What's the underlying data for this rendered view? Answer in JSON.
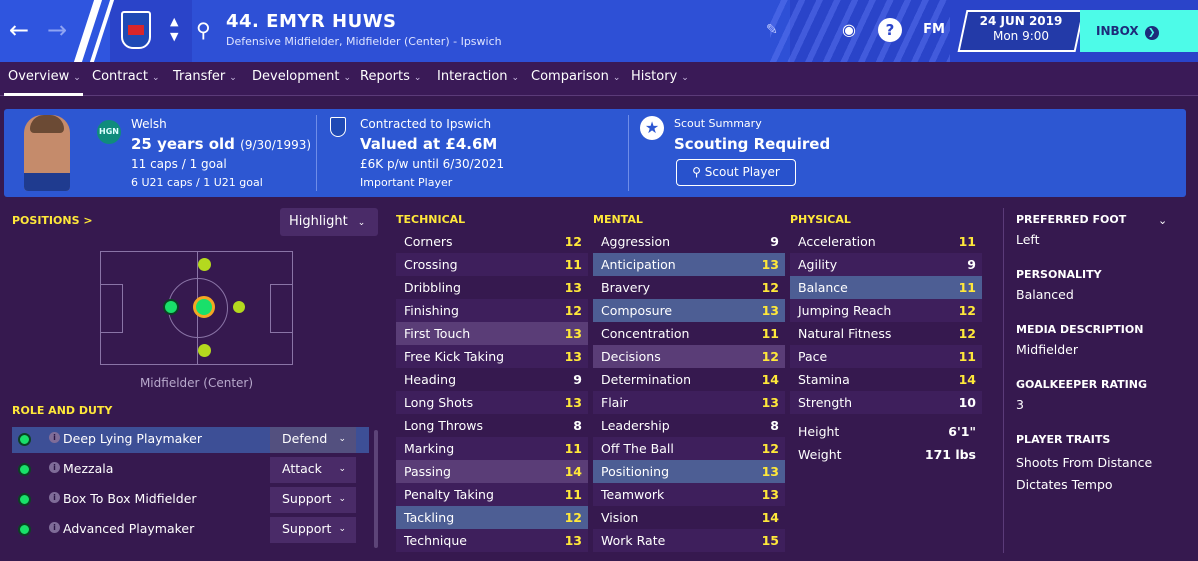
{
  "header": {
    "player_name": "44. EMYR HUWS",
    "player_sub": "Defensive Midfielder, Midfielder (Center) - Ipswich",
    "date": "24 JUN 2019",
    "time": "Mon 9:00",
    "fm_label": "FM",
    "inbox_label": "INBOX",
    "help_label": "?"
  },
  "tabs": [
    "Overview",
    "Contract",
    "Transfer",
    "Development",
    "Reports",
    "Interaction",
    "Comparison",
    "History"
  ],
  "summary": {
    "flag_text": "HGN",
    "nationality": "Welsh",
    "age": "25 years old",
    "dob": "(9/30/1993)",
    "caps": "11 caps / 1 goal",
    "u21": "6 U21 caps / 1 U21 goal",
    "contract_title": "Contracted to Ipswich",
    "value": "Valued at £4.6M",
    "wage": "£6K p/w until 6/30/2021",
    "status": "Important Player",
    "scout_title": "Scout Summary",
    "scout_status": "Scouting Required",
    "scout_button": "Scout Player"
  },
  "positions": {
    "title": "POSITIONS >",
    "highlight": "Highlight",
    "label": "Midfielder (Center)"
  },
  "roles": {
    "title": "ROLE AND DUTY",
    "items": [
      {
        "name": "Deep Lying Playmaker",
        "duty": "Defend"
      },
      {
        "name": "Mezzala",
        "duty": "Attack"
      },
      {
        "name": "Box To Box Midfielder",
        "duty": "Support"
      },
      {
        "name": "Advanced Playmaker",
        "duty": "Support"
      }
    ]
  },
  "technical": {
    "title": "TECHNICAL",
    "items": [
      {
        "n": "Corners",
        "v": "12"
      },
      {
        "n": "Crossing",
        "v": "11"
      },
      {
        "n": "Dribbling",
        "v": "13"
      },
      {
        "n": "Finishing",
        "v": "12"
      },
      {
        "n": "First Touch",
        "v": "13"
      },
      {
        "n": "Free Kick Taking",
        "v": "13"
      },
      {
        "n": "Heading",
        "v": "9"
      },
      {
        "n": "Long Shots",
        "v": "13"
      },
      {
        "n": "Long Throws",
        "v": "8"
      },
      {
        "n": "Marking",
        "v": "11"
      },
      {
        "n": "Passing",
        "v": "14"
      },
      {
        "n": "Penalty Taking",
        "v": "11"
      },
      {
        "n": "Tackling",
        "v": "12"
      },
      {
        "n": "Technique",
        "v": "13"
      }
    ]
  },
  "mental": {
    "title": "MENTAL",
    "items": [
      {
        "n": "Aggression",
        "v": "9"
      },
      {
        "n": "Anticipation",
        "v": "13"
      },
      {
        "n": "Bravery",
        "v": "12"
      },
      {
        "n": "Composure",
        "v": "13"
      },
      {
        "n": "Concentration",
        "v": "11"
      },
      {
        "n": "Decisions",
        "v": "12"
      },
      {
        "n": "Determination",
        "v": "14"
      },
      {
        "n": "Flair",
        "v": "13"
      },
      {
        "n": "Leadership",
        "v": "8"
      },
      {
        "n": "Off The Ball",
        "v": "12"
      },
      {
        "n": "Positioning",
        "v": "13"
      },
      {
        "n": "Teamwork",
        "v": "13"
      },
      {
        "n": "Vision",
        "v": "14"
      },
      {
        "n": "Work Rate",
        "v": "15"
      }
    ]
  },
  "physical": {
    "title": "PHYSICAL",
    "items": [
      {
        "n": "Acceleration",
        "v": "11"
      },
      {
        "n": "Agility",
        "v": "9"
      },
      {
        "n": "Balance",
        "v": "11"
      },
      {
        "n": "Jumping Reach",
        "v": "12"
      },
      {
        "n": "Natural Fitness",
        "v": "12"
      },
      {
        "n": "Pace",
        "v": "11"
      },
      {
        "n": "Stamina",
        "v": "14"
      },
      {
        "n": "Strength",
        "v": "10"
      }
    ],
    "height_label": "Height",
    "height": "6'1\"",
    "weight_label": "Weight",
    "weight": "171 lbs"
  },
  "right_panel": {
    "foot_title": "PREFERRED FOOT",
    "foot": "Left",
    "personality_title": "PERSONALITY",
    "personality": "Balanced",
    "media_title": "MEDIA DESCRIPTION",
    "media": "Midfielder",
    "gk_title": "GOALKEEPER RATING",
    "gk": "3",
    "traits_title": "PLAYER TRAITS",
    "traits": [
      "Shoots From Distance",
      "Dictates Tempo"
    ]
  }
}
